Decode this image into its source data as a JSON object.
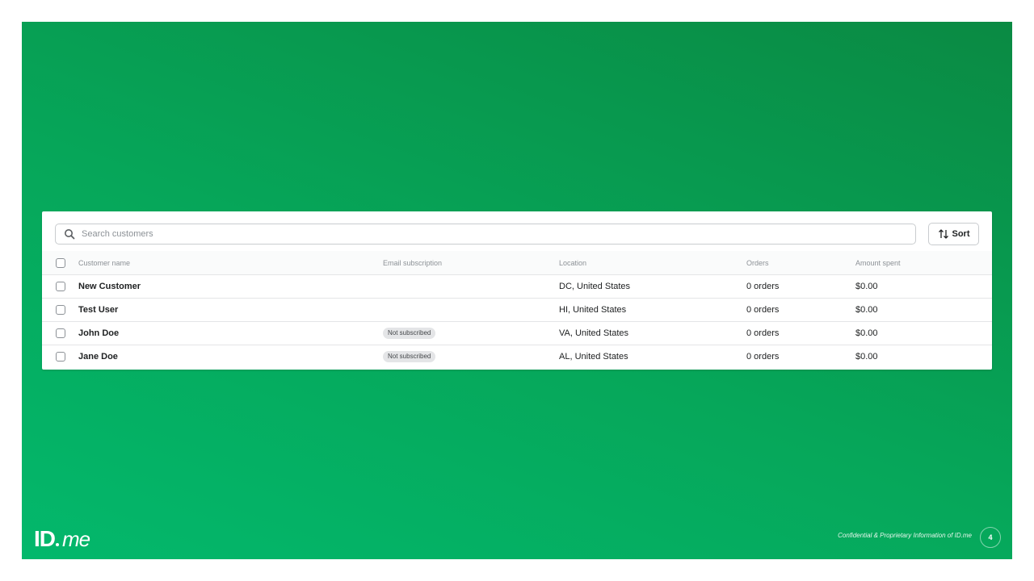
{
  "search": {
    "placeholder": "Search customers",
    "icon": "search-icon"
  },
  "sort": {
    "label": "Sort",
    "icon": "sort-arrows-icon"
  },
  "table": {
    "headers": {
      "name": "Customer name",
      "email": "Email subscription",
      "location": "Location",
      "orders": "Orders",
      "amount": "Amount spent"
    },
    "rows": [
      {
        "name": "New Customer",
        "email": "",
        "location": "DC, United States",
        "orders": "0 orders",
        "amount": "$0.00"
      },
      {
        "name": "Test User",
        "email": "",
        "location": "HI, United States",
        "orders": "0 orders",
        "amount": "$0.00"
      },
      {
        "name": "John Doe",
        "email": "Not subscribed",
        "location": "VA, United States",
        "orders": "0 orders",
        "amount": "$0.00"
      },
      {
        "name": "Jane Doe",
        "email": "Not subscribed",
        "location": "AL, United States",
        "orders": "0 orders",
        "amount": "$0.00"
      }
    ]
  },
  "footer": {
    "logo_id": "ID",
    "logo_me": "me",
    "confidential": "Confidential & Proprietary Information of ID.me",
    "page_number": "4"
  },
  "colors": {
    "background_green": "#06a75a",
    "panel": "#ffffff"
  }
}
